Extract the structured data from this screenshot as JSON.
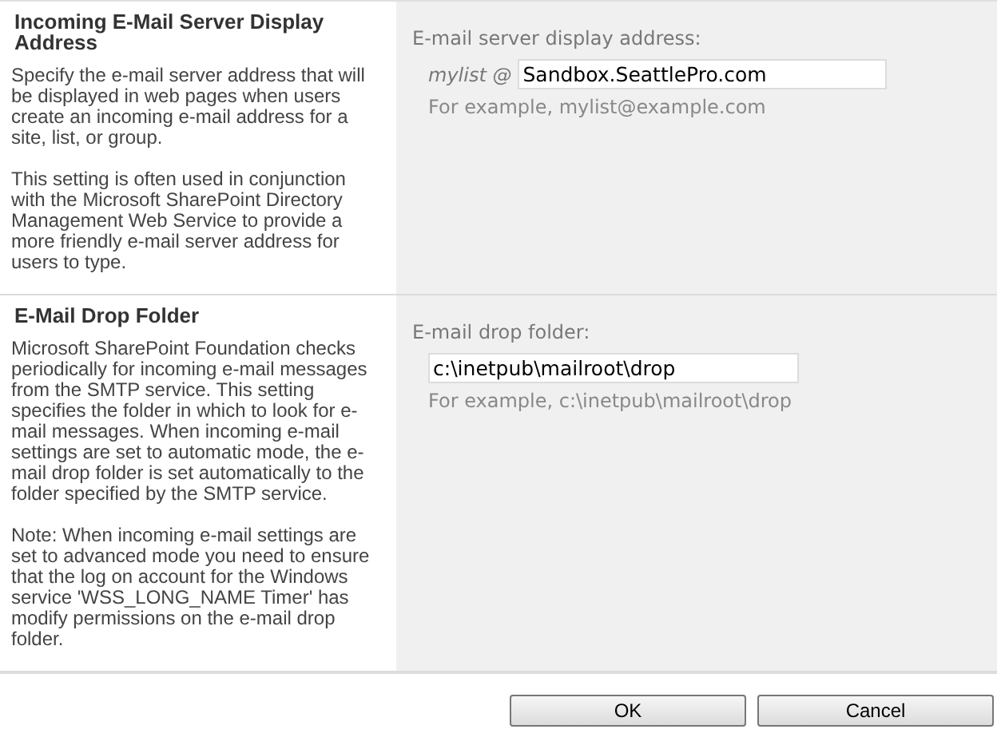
{
  "sections": [
    {
      "title": "Incoming E-Mail Server Display Address",
      "paragraphs": [
        "Specify the e-mail server address that will be displayed in web pages when users create an incoming e-mail address for a site, list, or group.",
        "This setting is often used in conjunction with the Microsoft SharePoint Directory Management Web Service to provide a more friendly e-mail server address for users to type."
      ],
      "field_label": "E-mail server display address:",
      "prefix": "mylist @",
      "value": "Sandbox.SeattlePro.com",
      "example": "For example, mylist@example.com"
    },
    {
      "title": "E-Mail Drop Folder",
      "paragraphs": [
        "Microsoft SharePoint Foundation checks periodically for incoming e-mail messages from the SMTP service. This setting specifies the folder in which to look for e-mail messages. When incoming e-mail settings are set to automatic mode, the e-mail drop folder is set automatically to the folder specified by the SMTP service.",
        "Note: When incoming e-mail settings are set to advanced mode you need to ensure that the log on account for the Windows service 'WSS_LONG_NAME Timer' has modify permissions on the e-mail drop folder."
      ],
      "field_label": "E-mail drop folder:",
      "value": "c:\\inetpub\\mailroot\\drop",
      "example": "For example, c:\\inetpub\\mailroot\\drop"
    }
  ],
  "buttons": [
    "OK",
    "Cancel"
  ]
}
